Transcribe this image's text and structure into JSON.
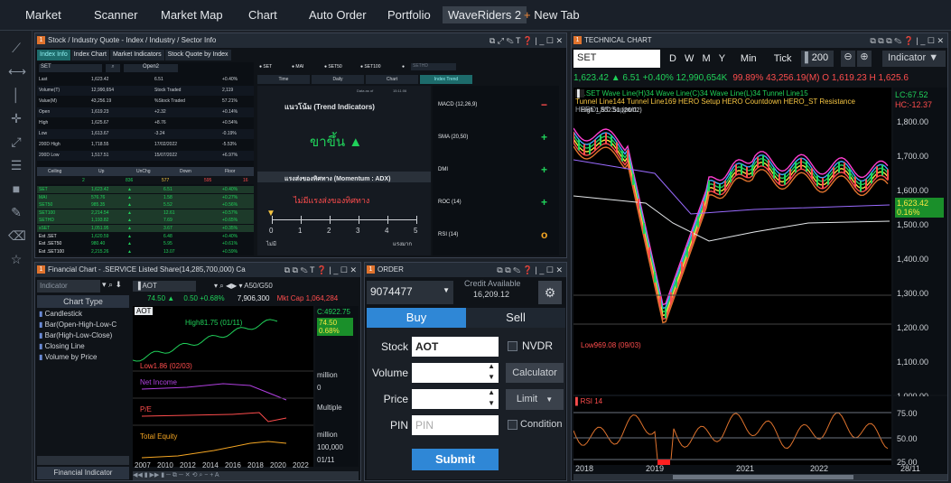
{
  "topnav": {
    "tabs": [
      "Market",
      "Scanner",
      "Market Map",
      "Chart",
      "Auto Order",
      "Portfolio",
      "WaveRiders 2"
    ],
    "new_tab": "+ New Tab"
  },
  "sidebar_icons": [
    "draw-line-icon",
    "horizontal-line-icon",
    "vertical-line-icon",
    "crosshair-icon",
    "trend-tool-icon",
    "fibonacci-icon",
    "rectangle-icon",
    "pencil-icon",
    "eraser-icon",
    "star-icon"
  ],
  "quote": {
    "title": "Stock / Industry Quote - Index / Industry / Sector Info",
    "tabs": [
      "Index Info",
      "Index Chart",
      "Market Indicators",
      "Stock Quote by Index"
    ],
    "symbol": "SET",
    "open_label": "Open2",
    "radio": [
      "SET",
      "MAI",
      "SET50",
      "SET100",
      "SETHD"
    ],
    "left_rows": [
      {
        "label": "Last",
        "v1": "1,623.42",
        "v2": "6.51",
        "v3": "+0.40%"
      },
      {
        "label": "Volume(T)",
        "v1": "12,990,654",
        "v2": "Stock Traded",
        "v3": "2,119"
      },
      {
        "label": "Value(M)",
        "v1": "43,256.19",
        "v2": "%Stock Traded",
        "v3": "57.21%"
      },
      {
        "label": "Open",
        "v1": "1,619.23",
        "v2": "+2.32",
        "v3": "+0.14%"
      },
      {
        "label": "High",
        "v1": "1,625.67",
        "v2": "+8.76",
        "v3": "+0.54%"
      },
      {
        "label": "Low",
        "v1": "1,613.67",
        "v2": "-3.24",
        "v3": "-0.19%"
      },
      {
        "label": "200D High",
        "v1": "1,718.55",
        "v2": "17/02/2022",
        "v3": "-5.53%"
      },
      {
        "label": "200D Low",
        "v1": "1,517.51",
        "v2": "15/07/2022",
        "v3": "+6.97%"
      }
    ],
    "ceiling_header": [
      "Ceiling",
      "Up",
      "UnChg",
      "Down",
      "Floor"
    ],
    "ceiling_values": [
      "2",
      "836",
      "577",
      "595",
      "16"
    ],
    "index_rows": [
      {
        "name": "SET",
        "v1": "1,623.42",
        "v2": "6.51",
        "v3": "+0.40%"
      },
      {
        "name": "MAI",
        "v1": "576.76",
        "v2": "1.58",
        "v3": "+0.27%"
      },
      {
        "name": "SET50",
        "v1": "985.35",
        "v2": "5.52",
        "v3": "+0.56%"
      },
      {
        "name": "SET100",
        "v1": "2,214.54",
        "v2": "12.61",
        "v3": "+0.57%"
      },
      {
        "name": "SETHD",
        "v1": "1,193.82",
        "v2": "7.69",
        "v3": "+0.65%"
      },
      {
        "name": "sSET",
        "v1": "1,051.95",
        "v2": "3.67",
        "v3": "+0.35%"
      },
      {
        "name": "Est .SET",
        "v1": "1,620.59",
        "v2": "6.48",
        "v3": "+0.40%"
      },
      {
        "name": "Est .SET50",
        "v1": "980.40",
        "v2": "5.95",
        "v3": "+0.61%"
      },
      {
        "name": "Est .SET100",
        "v1": "2,215.26",
        "v2": "13.07",
        "v3": "+0.59%"
      }
    ],
    "trend_tabs": [
      "Time",
      "Daily",
      "Chart",
      "Index Trend"
    ],
    "data_as_of": "Data as of",
    "time": "15:11:06",
    "trend_title": "แนวโน้ม (Trend Indicators)",
    "trend_text": "ขาขึ้น ▲",
    "momentum_title": "แรงส่งของทิศทาง (Momentum : ADX)",
    "momentum_text": "ไม่มีแรงส่งของทิศทาง",
    "scale": [
      "0",
      "1",
      "2",
      "3",
      "4",
      "5"
    ],
    "scale_low": "ไม่มี",
    "scale_high": "แรงมาก",
    "signals": [
      {
        "name": "MACD (12,26,9)",
        "sig": "−"
      },
      {
        "name": "SMA (20,50)",
        "sig": "+"
      },
      {
        "name": "DMI",
        "sig": "+"
      },
      {
        "name": "ROC (14)",
        "sig": "+"
      },
      {
        "name": "RSI (14)",
        "sig": "o"
      }
    ]
  },
  "technical": {
    "title": "TECHNICAL CHART",
    "symbol": "SET",
    "periods": [
      "D",
      "W",
      "M",
      "Y",
      "Min",
      "Tick"
    ],
    "count": "200",
    "indicator_btn": "Indicator ▼",
    "price_line": "1,623.42 ▲  6.51 +0.40%  12,990,654K",
    "price_line2": "99.89%  43,256.19(M) O 1,619.23 H 1,625.6",
    "legend1": ".SET  Wave Line(H)34  Wave Line(C)34  Wave Line(L)34  Tunnel Line15",
    "legend2": "Tunnel Line144  Tunnel Line169  HERO Setup  HERO Countdown  HERO_ST Resistance",
    "legend3": "HERO_ST Support",
    "high_label": "High 1,852.51 (26/02)",
    "low_label": "Low969.08 (09/03)",
    "lc_label": "LC:67.52",
    "hc_label": "HC:-12.37",
    "y_ticks": [
      "1,800.00",
      "1,700.00",
      "1,600.00",
      "1,500.00",
      "1,400.00",
      "1,300.00",
      "1,200.00",
      "1,100.00",
      "1,000.00"
    ],
    "last_tag": "1,623.42",
    "last_pct": "0.16%",
    "rsi_label": "RSI 14",
    "rsi_ticks": [
      "75.00",
      "50.00",
      "25.00"
    ],
    "x_ticks": [
      "2018",
      "2019",
      "2021",
      "2022",
      "28/11"
    ]
  },
  "financial": {
    "title": "Financial Chart - .SERVICE Listed Share(14,285,700,000) Ca",
    "indicator_placeholder": "Indicator",
    "chart_type_header": "Chart Type",
    "chart_types": [
      "Candlestick",
      "Bar(Open-High-Low-C",
      "Bar(High-Low-Close)",
      "Closing Line",
      "Volume by Price"
    ],
    "footer_btn": "Financial Indicator",
    "symbol": "AOT",
    "range_label": "A50/G50",
    "price": "74.50 ▲",
    "change": "0.50 +0.68%",
    "volume": "7,906,300",
    "mktcap": "Mkt Cap 1,064,284",
    "sub_symbol": "AOT",
    "high_note": "High81.75 (01/11)",
    "low_note": "Low1.86 (02/03)",
    "c_label": "C:4922.75",
    "price_tag": "74.50",
    "pct_tag": "0.68%",
    "panels": [
      {
        "name": "Net Income",
        "unit": "million",
        "tick": "0"
      },
      {
        "name": "P/E",
        "unit": "Multiple",
        "tick": "0"
      },
      {
        "name": "Total Equity",
        "unit": "million",
        "tick": "100,000"
      }
    ],
    "years": [
      "2007",
      "2010",
      "2012",
      "2014",
      "2016",
      "2018",
      "2020",
      "2022"
    ],
    "date_tag": "01/11"
  },
  "order": {
    "title": "ORDER",
    "account": "9074477",
    "credit_label": "Credit Available",
    "credit_value": "16,209.12",
    "buy": "Buy",
    "sell": "Sell",
    "stock_label": "Stock",
    "stock_value": "AOT",
    "nvdr": "NVDR",
    "volume_label": "Volume",
    "calculator": "Calculator",
    "price_label": "Price",
    "limit": "Limit",
    "pin_label": "PIN",
    "pin_placeholder": "PIN",
    "condition": "Condition",
    "submit": "Submit"
  },
  "colors": {
    "accent": "#2f87d6",
    "buy_tab": "#2f87d6",
    "up": "#20d15a",
    "down": "#ff4d4d",
    "orange": "#e0732d"
  }
}
